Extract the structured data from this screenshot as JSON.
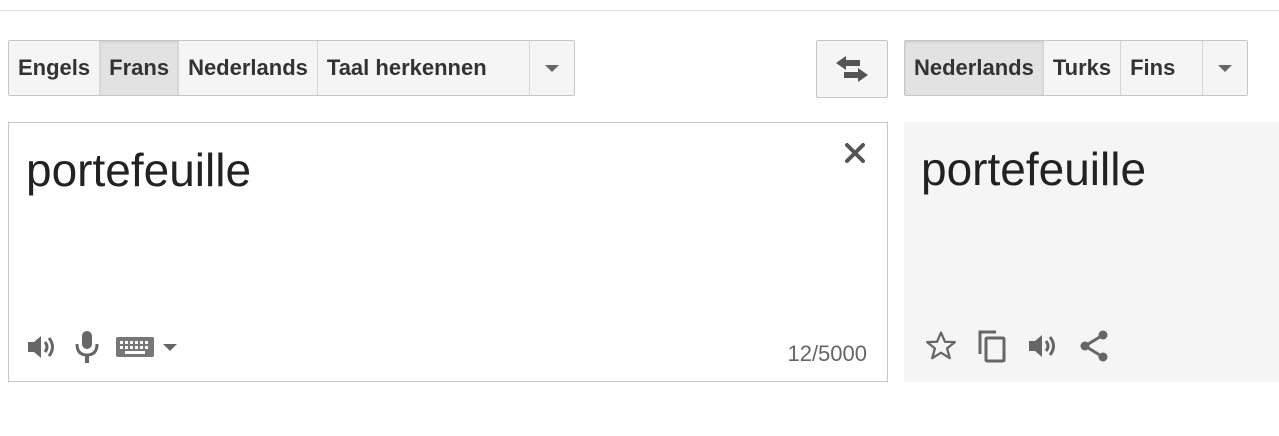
{
  "source_languages": {
    "items": [
      {
        "label": "Engels",
        "selected": false
      },
      {
        "label": "Frans",
        "selected": true
      },
      {
        "label": "Nederlands",
        "selected": false
      },
      {
        "label": "Taal herkennen",
        "selected": false
      }
    ],
    "more_icon": "chevron-down-icon"
  },
  "swap_icon": "swap-arrows-icon",
  "target_languages": {
    "items": [
      {
        "label": "Nederlands",
        "selected": true
      },
      {
        "label": "Turks",
        "selected": false
      },
      {
        "label": "Fins",
        "selected": false
      }
    ],
    "more_icon": "chevron-down-icon"
  },
  "source": {
    "text": "portefeuille",
    "char_count": "12/5000",
    "icons": [
      "close-icon",
      "speaker-icon",
      "microphone-icon",
      "keyboard-icon",
      "chevron-down-icon"
    ]
  },
  "result": {
    "text": "portefeuille",
    "icons": [
      "star-icon",
      "copy-icon",
      "speaker-icon",
      "share-icon"
    ]
  },
  "colors": {
    "toolbar_bg": "#f5f5f5",
    "selected_bg": "#e2e2e2",
    "border": "#c6c6c6",
    "result_bg": "#f5f5f5",
    "icon": "#666666"
  }
}
